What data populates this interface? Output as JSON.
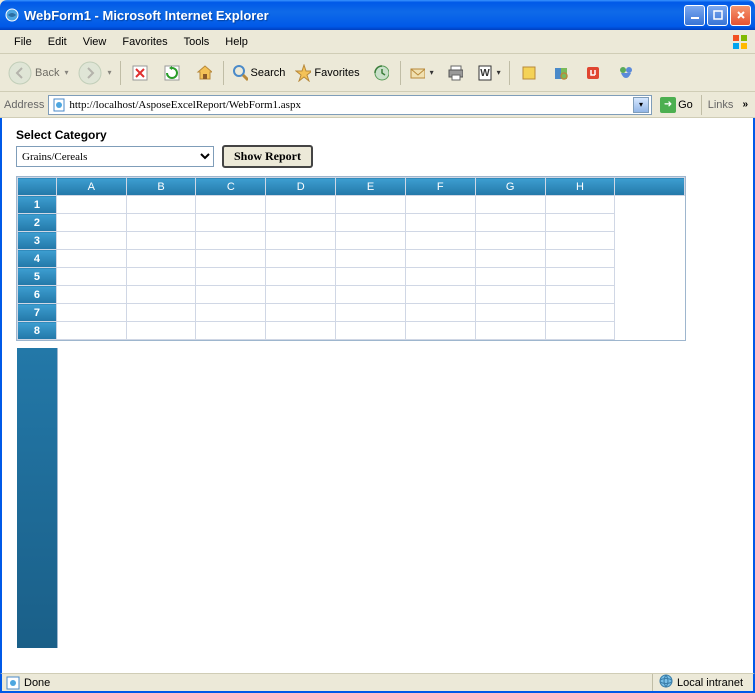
{
  "window": {
    "title": "WebForm1 - Microsoft Internet Explorer"
  },
  "menu": {
    "items": [
      "File",
      "Edit",
      "View",
      "Favorites",
      "Tools",
      "Help"
    ]
  },
  "toolbar": {
    "back_label": "Back",
    "search_label": "Search",
    "favorites_label": "Favorites"
  },
  "address": {
    "label": "Address",
    "url": "http://localhost/AsposeExcelReport/WebForm1.aspx",
    "go_label": "Go",
    "links_label": "Links"
  },
  "page": {
    "select_category_label": "Select Category",
    "selected_category": "Grains/Cereals",
    "show_report_label": "Show Report",
    "columns": [
      "A",
      "B",
      "C",
      "D",
      "E",
      "F",
      "G",
      "H"
    ],
    "rows": [
      "1",
      "2",
      "3",
      "4",
      "5",
      "6",
      "7",
      "8"
    ]
  },
  "status": {
    "text": "Done",
    "zone": "Local intranet"
  }
}
